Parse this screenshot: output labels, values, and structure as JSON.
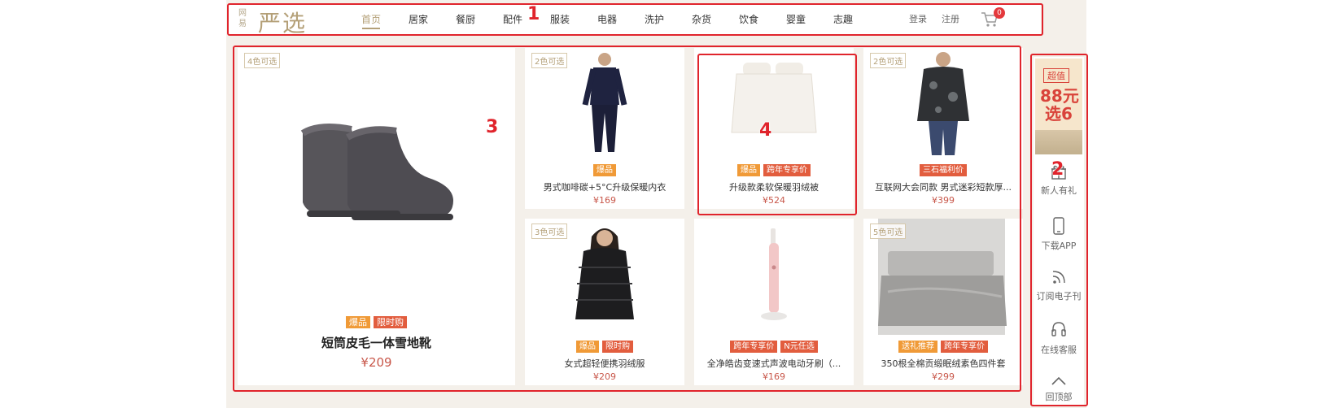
{
  "header": {
    "logo_small": "网易",
    "logo_big": "严选",
    "nav": [
      {
        "label": "首页",
        "active": true
      },
      {
        "label": "居家"
      },
      {
        "label": "餐厨"
      },
      {
        "label": "配件"
      },
      {
        "label": "服装"
      },
      {
        "label": "电器"
      },
      {
        "label": "洗护"
      },
      {
        "label": "杂货"
      },
      {
        "label": "饮食"
      },
      {
        "label": "婴童"
      },
      {
        "label": "志趣"
      }
    ],
    "login": "登录",
    "register": "注册",
    "cart_count": "0",
    "cart_icon": "shopping-cart-icon"
  },
  "products": [
    {
      "colors": "4色可选",
      "badges": [
        {
          "text": "爆品",
          "color": "#f09a37"
        },
        {
          "text": "限时购",
          "color": "#e25d3e"
        }
      ],
      "name": "短筒皮毛一体雪地靴",
      "price": "¥209",
      "image": "snow-boots"
    },
    {
      "colors": "2色可选",
      "badges": [
        {
          "text": "爆品",
          "color": "#f09a37"
        }
      ],
      "name": "男式咖啡碳+5°C升级保暖内衣",
      "price": "¥169",
      "image": "man-thermal-underwear"
    },
    {
      "colors": "",
      "badges": [
        {
          "text": "爆品",
          "color": "#f09a37"
        },
        {
          "text": "跨年专享价",
          "color": "#e25d3e"
        }
      ],
      "name": "升级款柔软保暖羽绒被",
      "price": "¥524",
      "image": "down-duvet"
    },
    {
      "colors": "2色可选",
      "badges": [
        {
          "text": "三石福利价",
          "color": "#e25d3e"
        }
      ],
      "name": "互联网大会同款 男式迷彩短款厚...",
      "price": "¥399",
      "image": "man-camo-jacket"
    },
    {
      "colors": "3色可选",
      "badges": [
        {
          "text": "爆品",
          "color": "#f09a37"
        },
        {
          "text": "限时购",
          "color": "#e25d3e"
        }
      ],
      "name": "女式超轻便携羽绒服",
      "price": "¥209",
      "image": "woman-down-jacket"
    },
    {
      "colors": "",
      "badges": [
        {
          "text": "跨年专享价",
          "color": "#e25d3e"
        },
        {
          "text": "N元任选",
          "color": "#e25d3e"
        }
      ],
      "name": "全净皓齿变速式声波电动牙刷（...",
      "price": "¥169",
      "image": "electric-toothbrush"
    },
    {
      "colors": "5色可选",
      "badges": [
        {
          "text": "送礼推荐",
          "color": "#f09a37"
        },
        {
          "text": "跨年专享价",
          "color": "#e25d3e"
        }
      ],
      "name": "350根全棉贡缎眠绒素色四件套",
      "price": "¥299",
      "image": "bedding-set"
    }
  ],
  "sidebar": {
    "promo": {
      "line1": "超值",
      "line2": "88元",
      "line3": "选6"
    },
    "items": [
      {
        "label": "新人有礼",
        "icon": "gift-icon"
      },
      {
        "label": "下载APP",
        "icon": "phone-icon"
      },
      {
        "label": "订阅电子刊",
        "icon": "rss-icon"
      },
      {
        "label": "在线客服",
        "icon": "headset-icon"
      },
      {
        "label": "回顶部",
        "icon": "chevron-up-icon"
      }
    ]
  },
  "annotations": [
    "1",
    "2",
    "3",
    "4"
  ],
  "colors": {
    "accent": "#b4a078",
    "annotation": "#e0242c",
    "price": "#c8574a"
  }
}
